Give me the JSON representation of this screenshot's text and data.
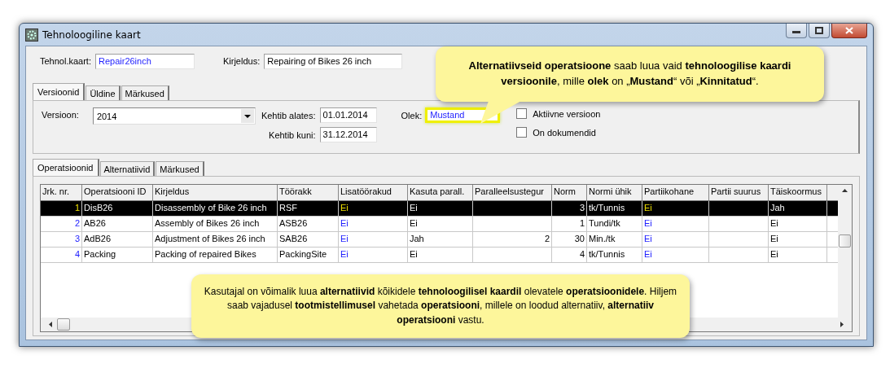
{
  "window": {
    "title": "Tehnoloogiline kaart"
  },
  "header": {
    "card_label": "Tehnol.kaart:",
    "card_value": "Repair26inch",
    "description_label": "Kirjeldus:",
    "description_value": "Repairing of Bikes 26 inch"
  },
  "tabs": [
    {
      "label": "Versioonid",
      "selected": true
    },
    {
      "label": "Üldine",
      "selected": false
    },
    {
      "label": "Märkused",
      "selected": false
    }
  ],
  "version": {
    "version_label": "Versioon:",
    "version_value": "2014",
    "from_label": "Kehtib alates:",
    "from_value": "01.01.2014",
    "to_label": "Kehtib kuni:",
    "to_value": "31.12.2014",
    "state_label": "Olek:",
    "state_value": "Mustand",
    "state_highlighted": true
  },
  "checkboxes": [
    {
      "label": "Aktiivne versioon",
      "checked": false
    },
    {
      "label": "On dokumendid",
      "checked": false
    }
  ],
  "inner_tabs": [
    {
      "label": "Operatsioonid",
      "selected": true
    },
    {
      "label": "Alternatiivid",
      "selected": false
    },
    {
      "label": "Märkused",
      "selected": false
    }
  ],
  "table": {
    "columns": [
      {
        "label": "Jrk. nr.",
        "kind": "index"
      },
      {
        "label": "Operatsiooni ID",
        "kind": "text"
      },
      {
        "label": "Kirjeldus",
        "kind": "text"
      },
      {
        "label": "Töörakk",
        "kind": "text"
      },
      {
        "label": "Lisatöörakud",
        "kind": "flag"
      },
      {
        "label": "Kasuta parall.",
        "kind": "text"
      },
      {
        "label": "Paralleelsustegur",
        "kind": "number"
      },
      {
        "label": "Norm",
        "kind": "number"
      },
      {
        "label": "Normi ühik",
        "kind": "text"
      },
      {
        "label": "Partiikohane",
        "kind": "flag"
      },
      {
        "label": "Partii suurus",
        "kind": "text"
      },
      {
        "label": "Täiskoormus",
        "kind": "text"
      }
    ],
    "rows": [
      {
        "selected": true,
        "cells": [
          "1",
          "DisB26",
          "Disassembly of Bike 26 inch",
          "RSF",
          "Ei",
          "Ei",
          "",
          "3",
          "tk/Tunnis",
          "Ei",
          "",
          "Jah"
        ]
      },
      {
        "selected": false,
        "cells": [
          "2",
          "AB26",
          "Assembly of Bikes 26 inch",
          "ASB26",
          "Ei",
          "Ei",
          "",
          "1",
          "Tundi/tk",
          "Ei",
          "",
          "Ei"
        ]
      },
      {
        "selected": false,
        "cells": [
          "3",
          "AdB26",
          "Adjustment of Bikes 26 inch",
          "SAB26",
          "Ei",
          "Jah",
          "2",
          "30",
          "Min./tk",
          "Ei",
          "",
          "Ei"
        ]
      },
      {
        "selected": false,
        "cells": [
          "4",
          "Packing",
          "Packing of repaired Bikes",
          "PackingSite",
          "Ei",
          "Ei",
          "",
          "4",
          "tk/Tunnis",
          "Ei",
          "",
          "Ei"
        ]
      }
    ]
  },
  "callouts": [
    {
      "text": "**Alternatiivseid operatsioone** saab luua vaid **tehnoloogilise kaardi versioonile**, mille **olek** on „**Mustand**“ või „**Kinnitatud**“."
    },
    {
      "text": "Kasutajal on võimalik luua **alternatiivid** kõikidele **tehnoloogilisel kaardil** olevatele **operatsioonidele**.  Hiljem saab vajadusel **tootmistellimusel** vahetada **operatsiooni**, millele on loodud alternatiiv, **alternatiiv operatsiooni** vastu."
    }
  ]
}
